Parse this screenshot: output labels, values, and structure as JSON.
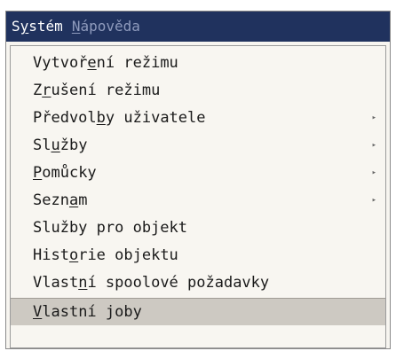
{
  "menubar": [
    {
      "before": "S",
      "key": "y",
      "after": "stém",
      "state": "active"
    },
    {
      "before": "",
      "key": "N",
      "after": "ápověda",
      "state": "disabled"
    }
  ],
  "menu_items": [
    {
      "before": "Vytvoř",
      "key": "e",
      "after": "ní režimu",
      "submenu": false,
      "selected": false
    },
    {
      "before": "Z",
      "key": "r",
      "after": "ušení režimu",
      "submenu": false,
      "selected": false
    },
    {
      "before": "Předvol",
      "key": "b",
      "after": "y uživatele",
      "submenu": true,
      "selected": false
    },
    {
      "before": "Sl",
      "key": "u",
      "after": "žby",
      "submenu": true,
      "selected": false
    },
    {
      "before": "",
      "key": "P",
      "after": "omůcky",
      "submenu": true,
      "selected": false
    },
    {
      "before": "Sezn",
      "key": "a",
      "after": "m",
      "submenu": true,
      "selected": false
    },
    {
      "before": "Služby pro objekt",
      "key": "",
      "after": "",
      "submenu": false,
      "selected": false
    },
    {
      "before": "Hist",
      "key": "o",
      "after": "rie objektu",
      "submenu": false,
      "selected": false
    },
    {
      "before": "Vlast",
      "key": "n",
      "after": "í spoolové požadavky",
      "submenu": false,
      "selected": false
    },
    {
      "before": "",
      "key": "V",
      "after": "lastní joby",
      "submenu": false,
      "selected": true
    }
  ],
  "submenu_arrow_glyph": "▸",
  "colors": {
    "menubar_bg": "#20325e",
    "menubar_active_text": "#ffffff",
    "menubar_disabled_text": "#8f9bbd",
    "dropdown_bg": "#f8f6f1",
    "selected_bg": "#cdc9c2"
  }
}
